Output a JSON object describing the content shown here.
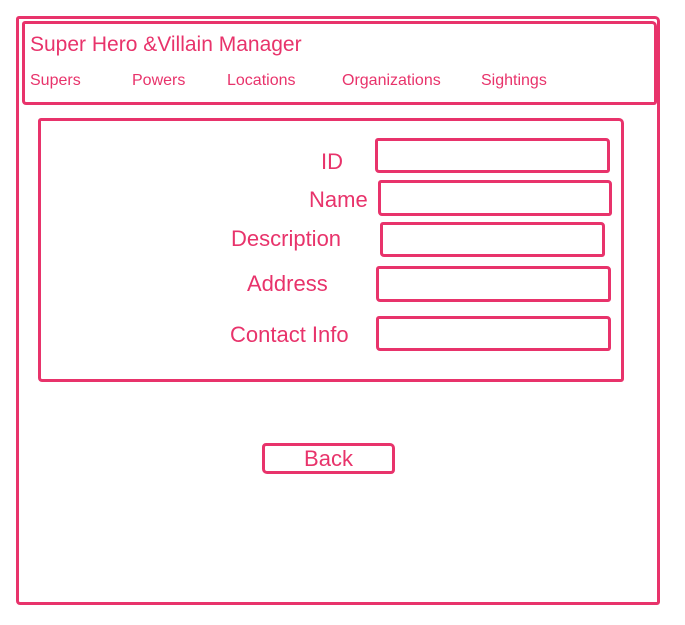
{
  "header": {
    "title": "Super Hero &Villain Manager",
    "nav": {
      "supers": "Supers",
      "powers": "Powers",
      "locations": "Locations",
      "organizations": "Organizations",
      "sightings": "Sightings"
    }
  },
  "form": {
    "fields": {
      "id": {
        "label": "ID",
        "value": ""
      },
      "name": {
        "label": "Name",
        "value": ""
      },
      "description": {
        "label": "Description",
        "value": ""
      },
      "address": {
        "label": "Address",
        "value": ""
      },
      "contact_info": {
        "label": "Contact Info",
        "value": ""
      }
    }
  },
  "actions": {
    "back_label": "Back"
  },
  "colors": {
    "accent": "#e8336b",
    "background": "#ffffff"
  }
}
